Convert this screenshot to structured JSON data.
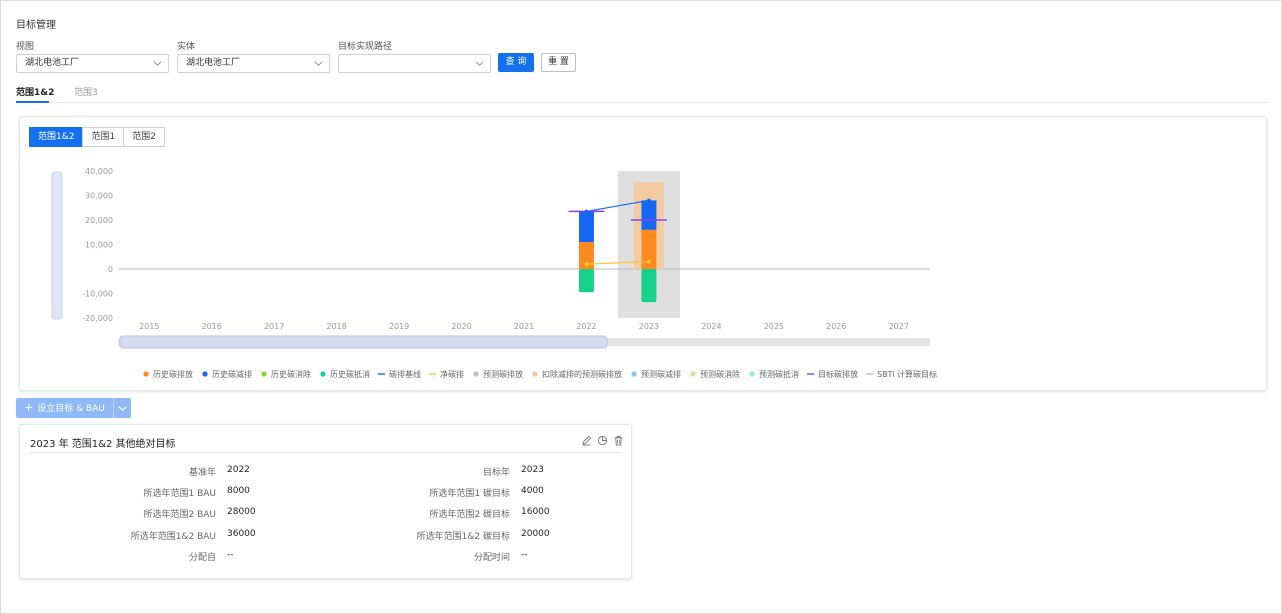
{
  "page": {
    "title": "目标管理"
  },
  "filters": {
    "view": {
      "label": "视图",
      "value": "湖北电池工厂"
    },
    "entity": {
      "label": "实体",
      "value": "湖北电池工厂"
    },
    "path": {
      "label": "目标实现路径",
      "value": ""
    },
    "query_label": "查 询",
    "reset_label": "重 置"
  },
  "scope_tabs": [
    {
      "label": "范围1&2",
      "active": true
    },
    {
      "label": "范围3",
      "active": false
    }
  ],
  "chart_tabs": [
    {
      "label": "范围1&2",
      "active": true
    },
    {
      "label": "范围1",
      "active": false
    },
    {
      "label": "范围2",
      "active": false
    }
  ],
  "colors": {
    "primary": "#1570ef",
    "orange": "#ff8a1f",
    "blue": "#1667f2",
    "green": "#17d08a",
    "purple": "#8a3ffc",
    "yellow": "#ffc53d",
    "light_orange": "#f7c99a"
  },
  "chart_data": {
    "type": "bar",
    "categories": [
      "2015",
      "2016",
      "2017",
      "2018",
      "2019",
      "2020",
      "2021",
      "2022",
      "2023",
      "2024",
      "2025",
      "2026",
      "2027"
    ],
    "y_ticks": [
      "40,000",
      "30,000",
      "20,000",
      "10,000",
      "0",
      "-10,000",
      "-20,000"
    ],
    "ylim": [
      -20000,
      40000
    ],
    "highlighted_category": "2023",
    "stacks": [
      {
        "category": "2022",
        "segments": [
          {
            "series": "历史碳排放",
            "from": 0,
            "to": 11000
          },
          {
            "series": "历史碳减排",
            "from": 11000,
            "to": 23500
          },
          {
            "series": "历史碳抵消",
            "from": 0,
            "to": -9500
          }
        ],
        "target": 23500,
        "net": 2000
      },
      {
        "category": "2023",
        "segments": [
          {
            "series": "扣除减排的预测碳排放",
            "from": 0,
            "to": 35500
          },
          {
            "series": "历史碳排放",
            "from": 0,
            "to": 16000
          },
          {
            "series": "历史碳减排",
            "from": 16000,
            "to": 28000
          },
          {
            "series": "历史碳抵消",
            "from": 0,
            "to": -13500
          }
        ],
        "target": 20000,
        "net": 3000
      }
    ],
    "baseline_line": [
      {
        "category": "2022",
        "y": 23500
      },
      {
        "category": "2023",
        "y": 28000
      }
    ],
    "net_line": [
      {
        "category": "2022",
        "y": 2000
      },
      {
        "category": "2023",
        "y": 3000
      }
    ],
    "legend": [
      {
        "name": "历史碳排放",
        "color": "#ff8a1f",
        "shape": "dot"
      },
      {
        "name": "历史碳减排",
        "color": "#1667f2",
        "shape": "dot"
      },
      {
        "name": "历史碳消除",
        "color": "#8fd422",
        "shape": "dot"
      },
      {
        "name": "历史碳抵消",
        "color": "#17d08a",
        "shape": "dot"
      },
      {
        "name": "碳排基线",
        "color": "#1667f2",
        "shape": "line"
      },
      {
        "name": "净碳排",
        "color": "#ffc53d",
        "shape": "line"
      },
      {
        "name": "预测碳排放",
        "color": "#bfbfbf",
        "shape": "dot"
      },
      {
        "name": "扣除减排的预测碳排放",
        "color": "#f7c99a",
        "shape": "dot"
      },
      {
        "name": "预测碳减排",
        "color": "#91c1f7",
        "shape": "dot"
      },
      {
        "name": "预测碳消除",
        "color": "#c5e88d",
        "shape": "dot"
      },
      {
        "name": "预测碳抵消",
        "color": "#9ee9cc",
        "shape": "dot"
      },
      {
        "name": "目标碳排放",
        "color": "#8a3ffc",
        "shape": "line"
      },
      {
        "name": "SBTi 计算碳目标",
        "color": "#bfbfbf",
        "shape": "line"
      }
    ]
  },
  "add_button": {
    "label": "设立目标 & BAU"
  },
  "target": {
    "title": "2023 年 范围1&2 其他绝对目标",
    "left": [
      {
        "label": "基准年",
        "value": "2022"
      },
      {
        "label": "所选年范围1 BAU",
        "value": "8000"
      },
      {
        "label": "所选年范围2 BAU",
        "value": "28000"
      },
      {
        "label": "所选年范围1&2 BAU",
        "value": "36000"
      },
      {
        "label": "分配自",
        "value": "--"
      }
    ],
    "right": [
      {
        "label": "目标年",
        "value": "2023"
      },
      {
        "label": "所选年范围1 碳目标",
        "value": "4000"
      },
      {
        "label": "所选年范围2 碳目标",
        "value": "16000"
      },
      {
        "label": "所选年范围1&2 碳目标",
        "value": "20000"
      },
      {
        "label": "分配时间",
        "value": "--"
      }
    ]
  }
}
